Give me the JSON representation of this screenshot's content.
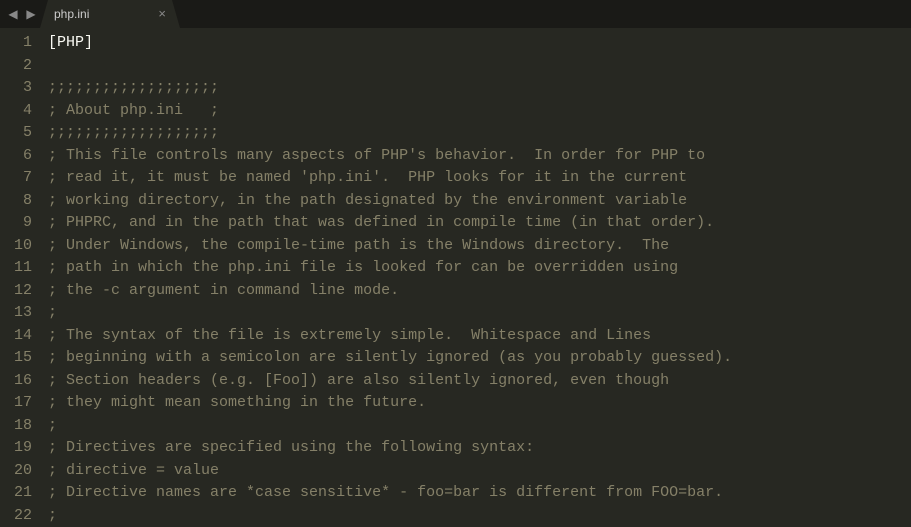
{
  "tab": {
    "title": "php.ini",
    "close_symbol": "×"
  },
  "nav": {
    "left": "◀",
    "right": "▶"
  },
  "lines": [
    {
      "n": 1,
      "kind": "section",
      "text": "[PHP]"
    },
    {
      "n": 2,
      "kind": "blank",
      "text": ""
    },
    {
      "n": 3,
      "kind": "comment",
      "text": ";;;;;;;;;;;;;;;;;;;"
    },
    {
      "n": 4,
      "kind": "comment",
      "text": "; About php.ini   ;"
    },
    {
      "n": 5,
      "kind": "comment",
      "text": ";;;;;;;;;;;;;;;;;;;"
    },
    {
      "n": 6,
      "kind": "comment",
      "text": "; This file controls many aspects of PHP's behavior.  In order for PHP to"
    },
    {
      "n": 7,
      "kind": "comment",
      "text": "; read it, it must be named 'php.ini'.  PHP looks for it in the current"
    },
    {
      "n": 8,
      "kind": "comment",
      "text": "; working directory, in the path designated by the environment variable"
    },
    {
      "n": 9,
      "kind": "comment",
      "text": "; PHPRC, and in the path that was defined in compile time (in that order)."
    },
    {
      "n": 10,
      "kind": "comment",
      "text": "; Under Windows, the compile-time path is the Windows directory.  The"
    },
    {
      "n": 11,
      "kind": "comment",
      "text": "; path in which the php.ini file is looked for can be overridden using"
    },
    {
      "n": 12,
      "kind": "comment",
      "text": "; the -c argument in command line mode."
    },
    {
      "n": 13,
      "kind": "comment",
      "text": ";"
    },
    {
      "n": 14,
      "kind": "comment",
      "text": "; The syntax of the file is extremely simple.  Whitespace and Lines"
    },
    {
      "n": 15,
      "kind": "comment",
      "text": "; beginning with a semicolon are silently ignored (as you probably guessed)."
    },
    {
      "n": 16,
      "kind": "comment",
      "text": "; Section headers (e.g. [Foo]) are also silently ignored, even though"
    },
    {
      "n": 17,
      "kind": "comment",
      "text": "; they might mean something in the future."
    },
    {
      "n": 18,
      "kind": "comment",
      "text": ";"
    },
    {
      "n": 19,
      "kind": "comment",
      "text": "; Directives are specified using the following syntax:"
    },
    {
      "n": 20,
      "kind": "comment",
      "text": "; directive = value"
    },
    {
      "n": 21,
      "kind": "comment",
      "text": "; Directive names are *case sensitive* - foo=bar is different from FOO=bar."
    },
    {
      "n": 22,
      "kind": "comment",
      "text": ";"
    }
  ]
}
